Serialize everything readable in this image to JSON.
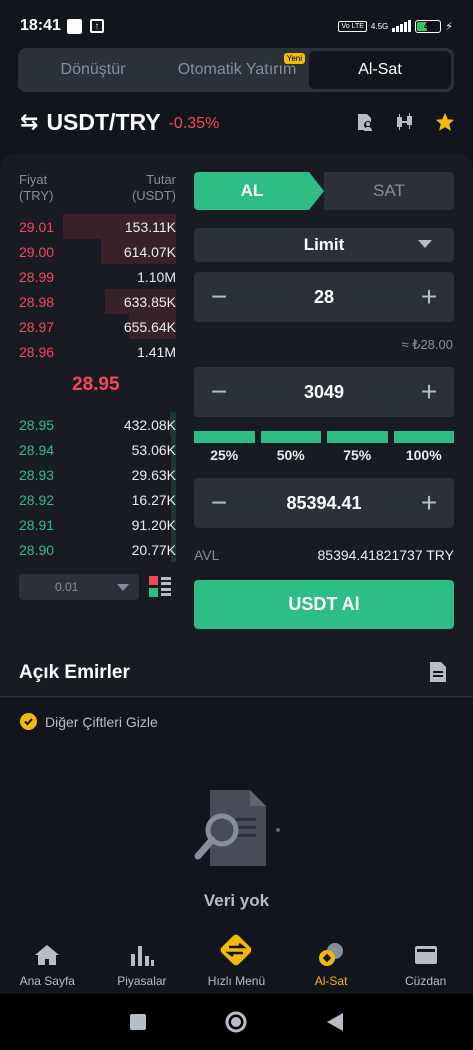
{
  "status": {
    "time": "18:41",
    "network": "4.5G",
    "volte": "Vo LTE",
    "battery": "45",
    "battery_level": 0.45
  },
  "tabs": [
    {
      "label": "Dönüştür",
      "active": false
    },
    {
      "label": "Otomatik Yatırım",
      "active": false,
      "badge": "Yeni"
    },
    {
      "label": "Al-Sat",
      "active": true
    }
  ],
  "pair": {
    "name": "USDT/TRY",
    "change": "-0.35%"
  },
  "orderbook": {
    "price_header": [
      "Fiyat",
      "(TRY)"
    ],
    "amount_header": [
      "Tutar",
      "(USDT)"
    ],
    "asks": [
      {
        "price": "29.01",
        "amount": "153.11K",
        "depth": 0.72
      },
      {
        "price": "29.00",
        "amount": "614.07K",
        "depth": 0.48
      },
      {
        "price": "28.99",
        "amount": "1.10M",
        "depth": 0.0
      },
      {
        "price": "28.98",
        "amount": "633.85K",
        "depth": 0.45
      },
      {
        "price": "28.97",
        "amount": "655.64K",
        "depth": 0.3
      },
      {
        "price": "28.96",
        "amount": "1.41M",
        "depth": 0.0
      }
    ],
    "mid_price": "28.95",
    "bids": [
      {
        "price": "28.95",
        "amount": "432.08K",
        "depth": 0.04
      },
      {
        "price": "28.94",
        "amount": "53.06K",
        "depth": 0.03
      },
      {
        "price": "28.93",
        "amount": "29.63K",
        "depth": 0.03
      },
      {
        "price": "28.92",
        "amount": "16.27K",
        "depth": 0.03
      },
      {
        "price": "28.91",
        "amount": "91.20K",
        "depth": 0.03
      },
      {
        "price": "28.90",
        "amount": "20.77K",
        "depth": 0.03
      }
    ],
    "precision": "0.01"
  },
  "trade": {
    "buy_label": "AL",
    "sell_label": "SAT",
    "order_type": "Limit",
    "price": "28",
    "price_approx": "≈ ₺28.00",
    "amount": "3049",
    "percentages": [
      "25%",
      "50%",
      "75%",
      "100%"
    ],
    "total": "85394.41",
    "avl_label": "AVL",
    "avl_value": "85394.41821737 TRY",
    "submit_label": "USDT Al"
  },
  "open_orders": {
    "title": "Açık Emirler",
    "hide_others": "Diğer Çiftleri Gizle",
    "empty": "Veri yok"
  },
  "bottom_nav": [
    {
      "label": "Ana Sayfa",
      "icon": "home-icon",
      "active": false
    },
    {
      "label": "Piyasalar",
      "icon": "markets-icon",
      "active": false
    },
    {
      "label": "Hızlı Menü",
      "icon": "quick-menu-icon",
      "active": false
    },
    {
      "label": "Al-Sat",
      "icon": "trade-icon",
      "active": true
    },
    {
      "label": "Cüzdan",
      "icon": "wallet-icon",
      "active": false
    }
  ],
  "colors": {
    "green": "#2ebd85",
    "red": "#f6465d",
    "yellow": "#f0b90b",
    "background": "#12161c"
  }
}
